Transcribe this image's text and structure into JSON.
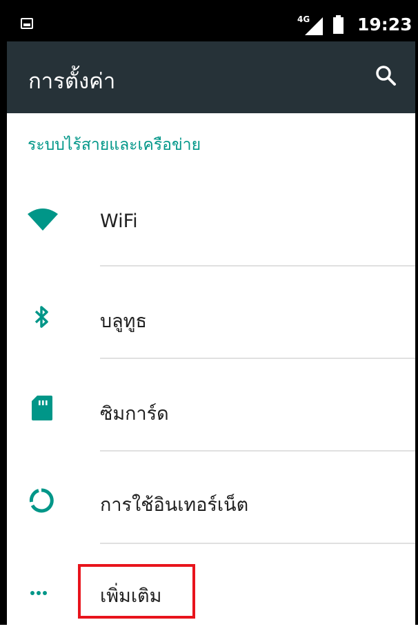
{
  "status_bar": {
    "network": "4G",
    "time": "19:23"
  },
  "toolbar": {
    "title": "การตั้งค่า",
    "search_icon": "search-icon"
  },
  "section": {
    "header": "ระบบไร้สายและเครือข่าย"
  },
  "items": [
    {
      "label": "WiFi",
      "icon": "wifi-icon"
    },
    {
      "label": "บลูทูธ",
      "icon": "bluetooth-icon"
    },
    {
      "label": "ซิมการ์ด",
      "icon": "sim-card-icon"
    },
    {
      "label": "การใช้อินเทอร์เน็ต",
      "icon": "data-usage-icon"
    },
    {
      "label": "เพิ่มเติม",
      "icon": "more-icon"
    }
  ],
  "colors": {
    "accent": "#009688",
    "toolbar": "#263238",
    "highlight": "#e8141c"
  }
}
